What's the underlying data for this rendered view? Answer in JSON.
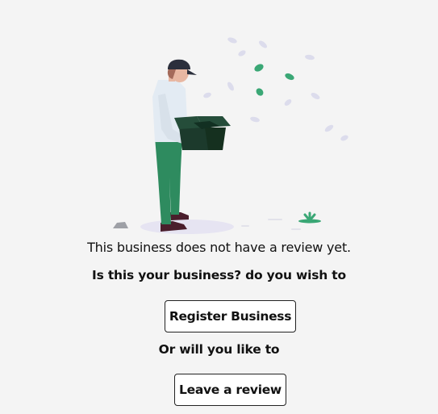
{
  "empty_state": {
    "illustration": "person-holding-open-box-illustration",
    "message": "This business does not have a review yet.",
    "question": "Is this your business? do you wish to",
    "register_button_label": "Register Business",
    "alternative_text": "Or will you like to",
    "review_button_label": "Leave a review"
  },
  "colors": {
    "background": "#f4f4f4",
    "pants": "#2e8b5f",
    "box": "#1c3a2c",
    "shirt": "#e3ebf3",
    "leaf": "#3aa775",
    "button_border": "#222222"
  }
}
